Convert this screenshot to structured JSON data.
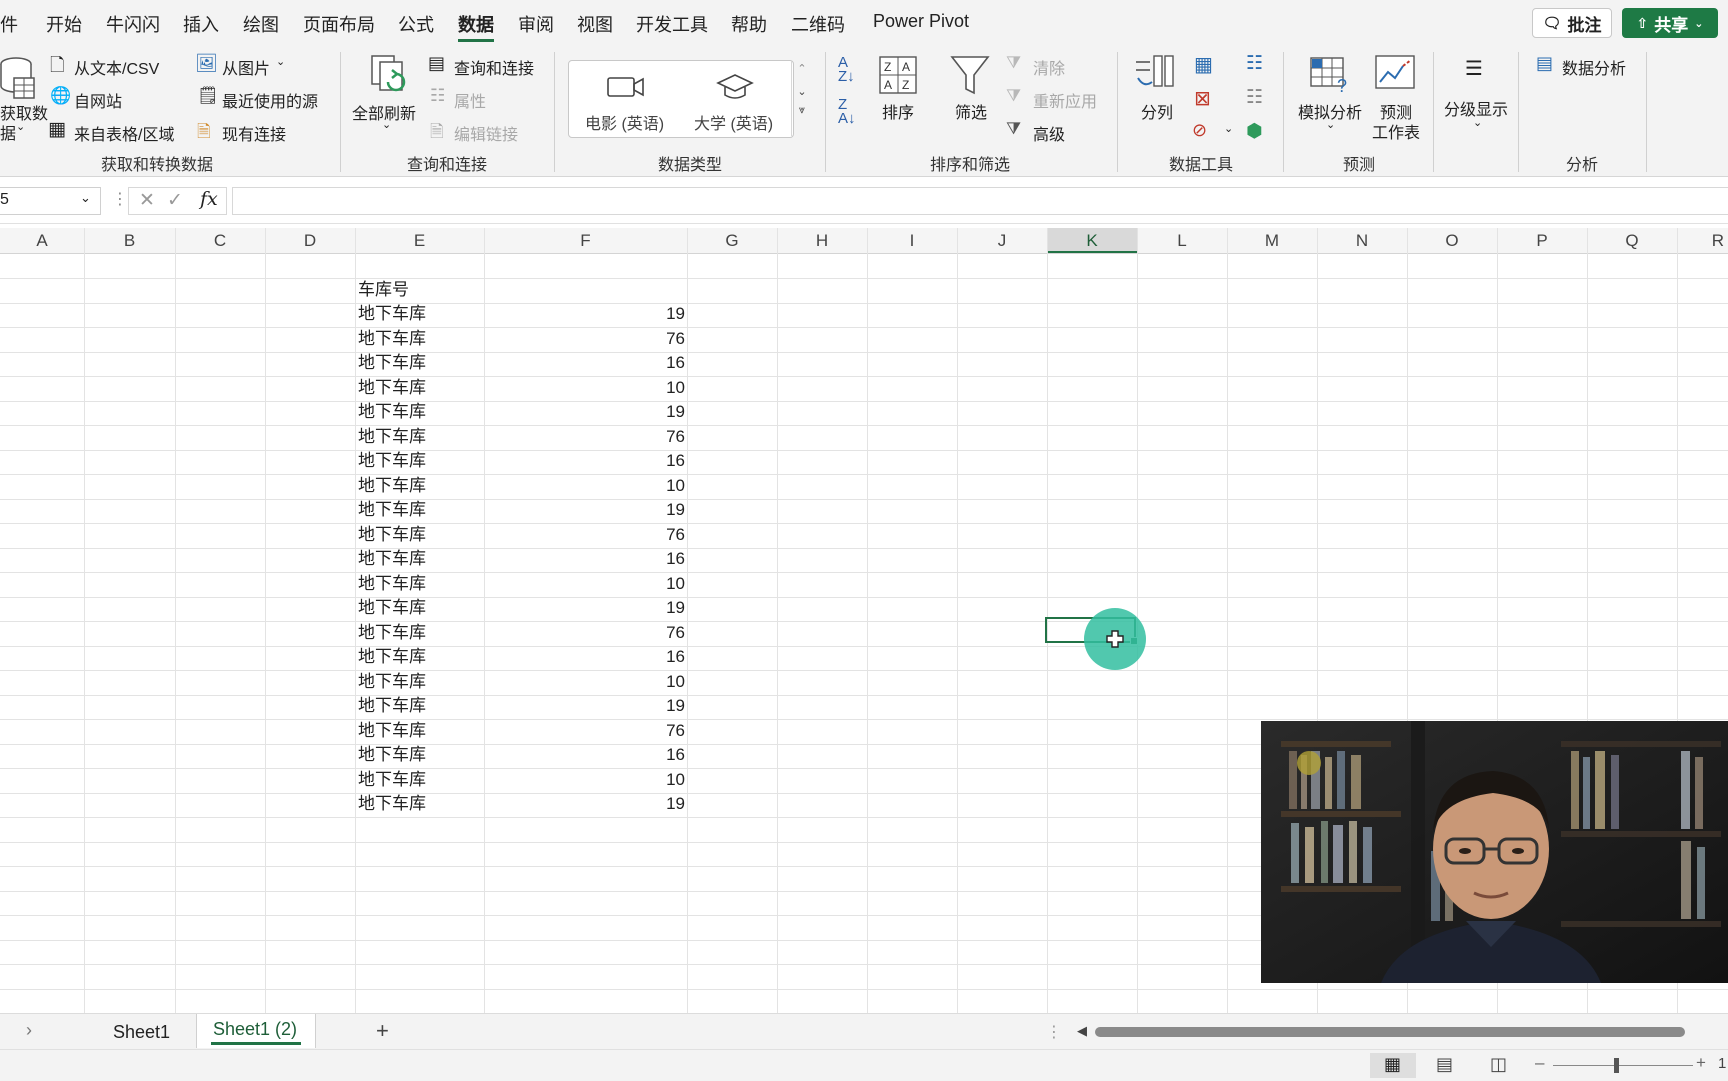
{
  "menu": {
    "items": [
      "件",
      "开始",
      "牛闪闪",
      "插入",
      "绘图",
      "页面布局",
      "公式",
      "数据",
      "审阅",
      "视图",
      "开发工具",
      "帮助",
      "二维码",
      "Power Pivot"
    ],
    "active": "数据",
    "comment_btn": "批注",
    "share_btn": "共享"
  },
  "ribbon": {
    "get_data_line1": "获取数",
    "get_data_line2": "据",
    "from_text": "从文本/CSV",
    "from_web": "自网站",
    "from_table": "来自表格/区域",
    "from_picture": "从图片",
    "recent_sources": "最近使用的源",
    "existing_connections": "现有连接",
    "group_get_transform": "获取和转换数据",
    "refresh_all": "全部刷新",
    "queries_connections": "查询和连接",
    "properties": "属性",
    "edit_links": "编辑链接",
    "group_queries": "查询和连接",
    "type_movie": "电影 (英语)",
    "type_university": "大学 (英语)",
    "group_data_types": "数据类型",
    "sort": "排序",
    "filter": "筛选",
    "clear": "清除",
    "reapply": "重新应用",
    "advanced": "高级",
    "group_sort_filter": "排序和筛选",
    "text_to_columns": "分列",
    "group_data_tools": "数据工具",
    "what_if": "模拟分析",
    "forecast_line1": "预测",
    "forecast_line2": "工作表",
    "group_forecast": "预测",
    "outline": "分级显示",
    "data_analysis": "数据分析",
    "group_analysis": "分析"
  },
  "formula_bar": {
    "name_box": "5",
    "fx": "fx",
    "content": ""
  },
  "columns": [
    "A",
    "B",
    "C",
    "D",
    "E",
    "F",
    "G",
    "H",
    "I",
    "J",
    "K",
    "L",
    "M",
    "N",
    "O",
    "P",
    "Q",
    "R"
  ],
  "selected_column": "K",
  "sheet": {
    "header": "车库号",
    "rows": [
      {
        "label": "地下车库",
        "value": "19"
      },
      {
        "label": "地下车库",
        "value": "76"
      },
      {
        "label": "地下车库",
        "value": "16"
      },
      {
        "label": "地下车库",
        "value": "10"
      },
      {
        "label": "地下车库",
        "value": "19"
      },
      {
        "label": "地下车库",
        "value": "76"
      },
      {
        "label": "地下车库",
        "value": "16"
      },
      {
        "label": "地下车库",
        "value": "10"
      },
      {
        "label": "地下车库",
        "value": "19"
      },
      {
        "label": "地下车库",
        "value": "76"
      },
      {
        "label": "地下车库",
        "value": "16"
      },
      {
        "label": "地下车库",
        "value": "10"
      },
      {
        "label": "地下车库",
        "value": "19"
      },
      {
        "label": "地下车库",
        "value": "76"
      },
      {
        "label": "地下车库",
        "value": "16"
      },
      {
        "label": "地下车库",
        "value": "10"
      },
      {
        "label": "地下车库",
        "value": "19"
      },
      {
        "label": "地下车库",
        "value": "76"
      },
      {
        "label": "地下车库",
        "value": "16"
      },
      {
        "label": "地下车库",
        "value": "10"
      },
      {
        "label": "地下车库",
        "value": "19"
      }
    ]
  },
  "tabs": {
    "sheets": [
      "Sheet1",
      "Sheet1 (2)"
    ],
    "active": "Sheet1 (2)",
    "add": "+"
  },
  "status": {
    "zoom_tail": "1"
  },
  "colors": {
    "accent": "#217346",
    "cursor": "#32bea0"
  }
}
